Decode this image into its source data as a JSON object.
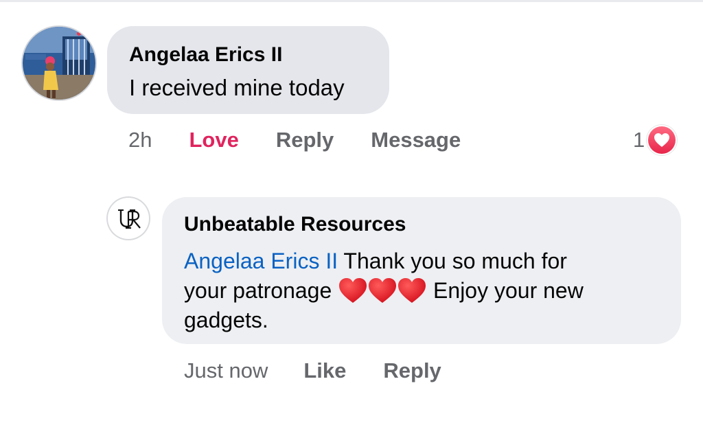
{
  "comment": {
    "author": "Angelaa Erics II",
    "text": "I received mine today",
    "time": "2h",
    "love_label": "Love",
    "reply_label": "Reply",
    "message_label": "Message",
    "reaction_count": "1",
    "reaction_type": "love",
    "accent_color": "#e0245e"
  },
  "reply": {
    "author": "Unbeatable Resources",
    "avatar_monogram": "UR",
    "mention": "Angelaa Erics II",
    "text_line1": " Thank you so much for",
    "text_line2_part1": "your patronage ",
    "text_line2_part2": " Enjoy your new",
    "text_line3": "gadgets.",
    "emoji": "❤️❤️❤️",
    "time": "Just now",
    "like_label": "Like",
    "reply_label": "Reply",
    "mention_color": "#0a62c3"
  }
}
